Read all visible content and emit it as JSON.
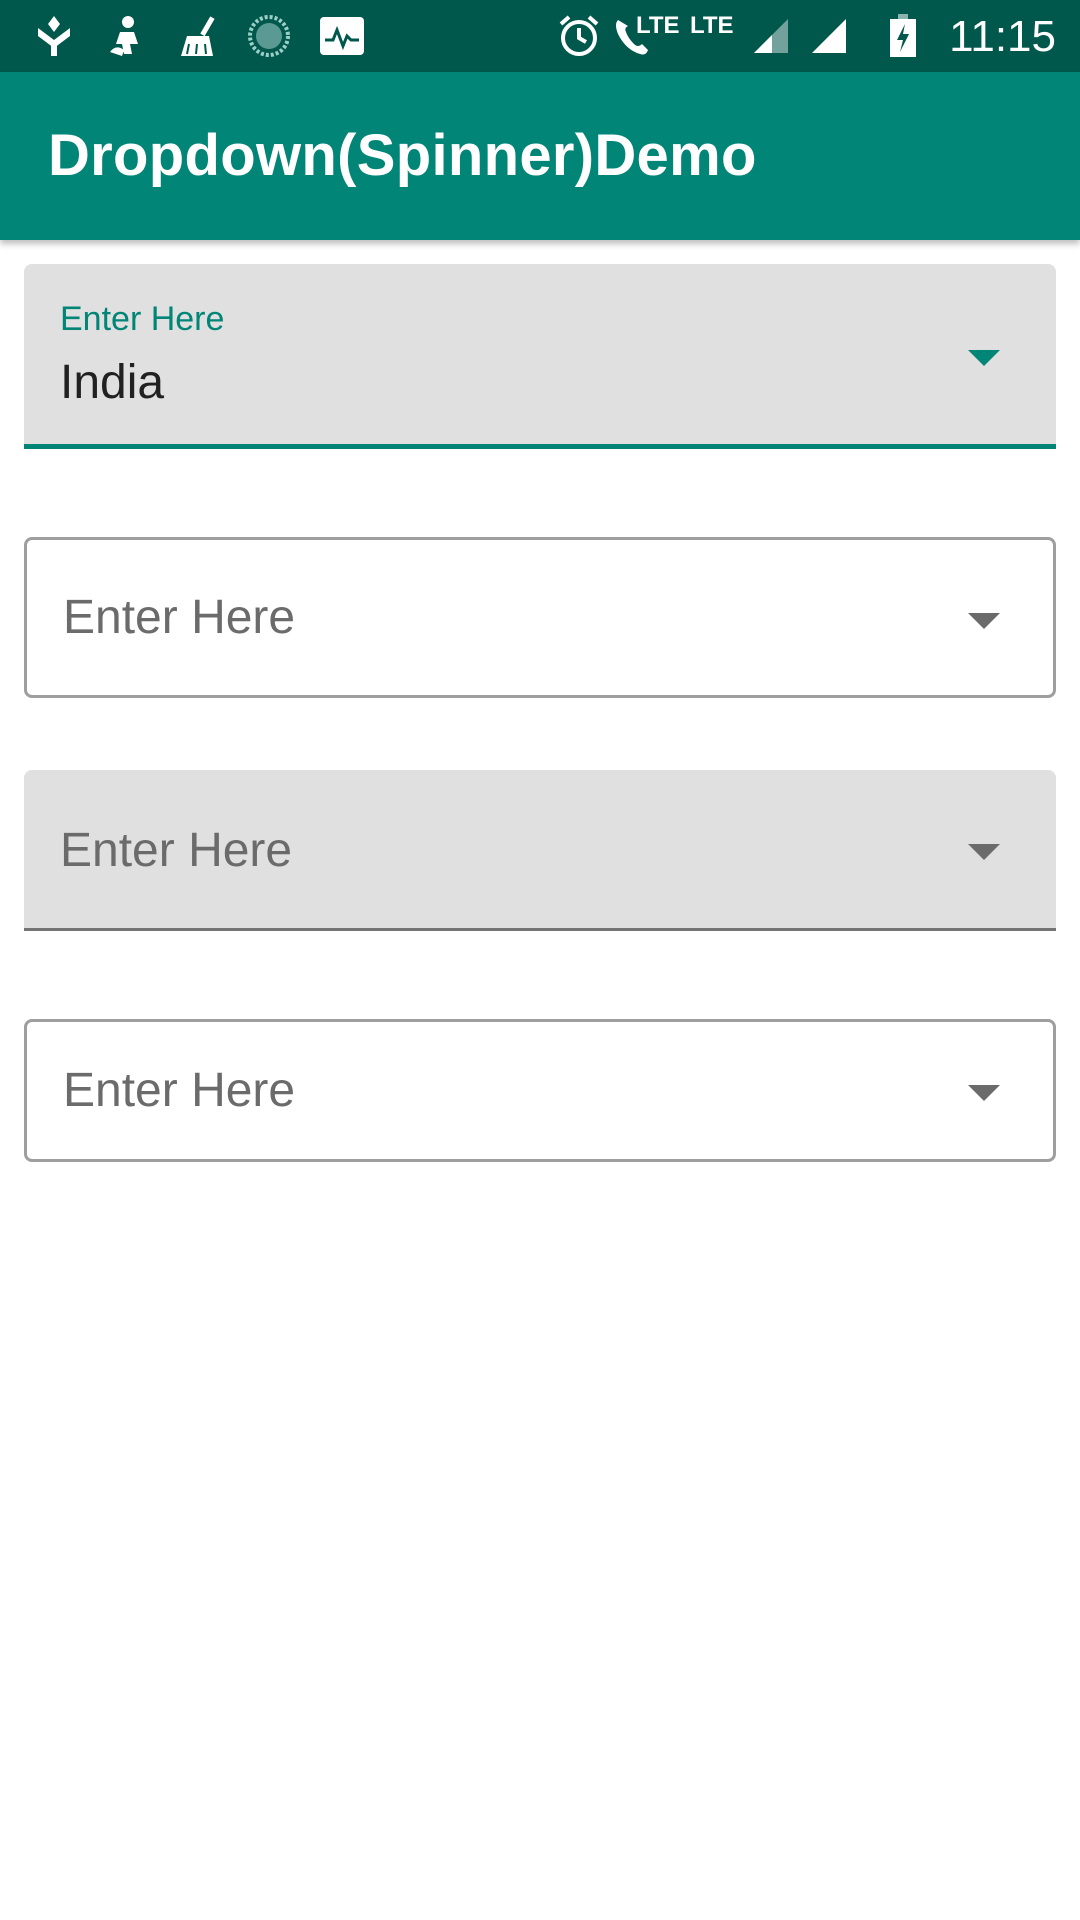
{
  "status_bar": {
    "time": "11:15",
    "lte_1": "LTE",
    "lte_2": "LTE",
    "icons": [
      "app-notification-icon",
      "person-icon",
      "broom-icon",
      "sync-progress-icon",
      "activity-graph-icon",
      "alarm-icon",
      "wifi-calling-icon",
      "signal-icon",
      "signal-icon",
      "battery-charging-icon"
    ]
  },
  "app_bar": {
    "title": "Dropdown(Spinner)Demo",
    "color": "#008577"
  },
  "fields": [
    {
      "style": "filled",
      "label": "Enter Here",
      "value": "India",
      "focused": true
    },
    {
      "style": "outlined",
      "hint": "Enter Here"
    },
    {
      "style": "filled",
      "hint": "Enter Here"
    },
    {
      "style": "outlined",
      "hint": "Enter Here"
    }
  ],
  "colors": {
    "accent": "#008577",
    "status_bar": "#00574b",
    "hint": "#6b6b6b",
    "filled_bg": "#e0e0e0"
  }
}
